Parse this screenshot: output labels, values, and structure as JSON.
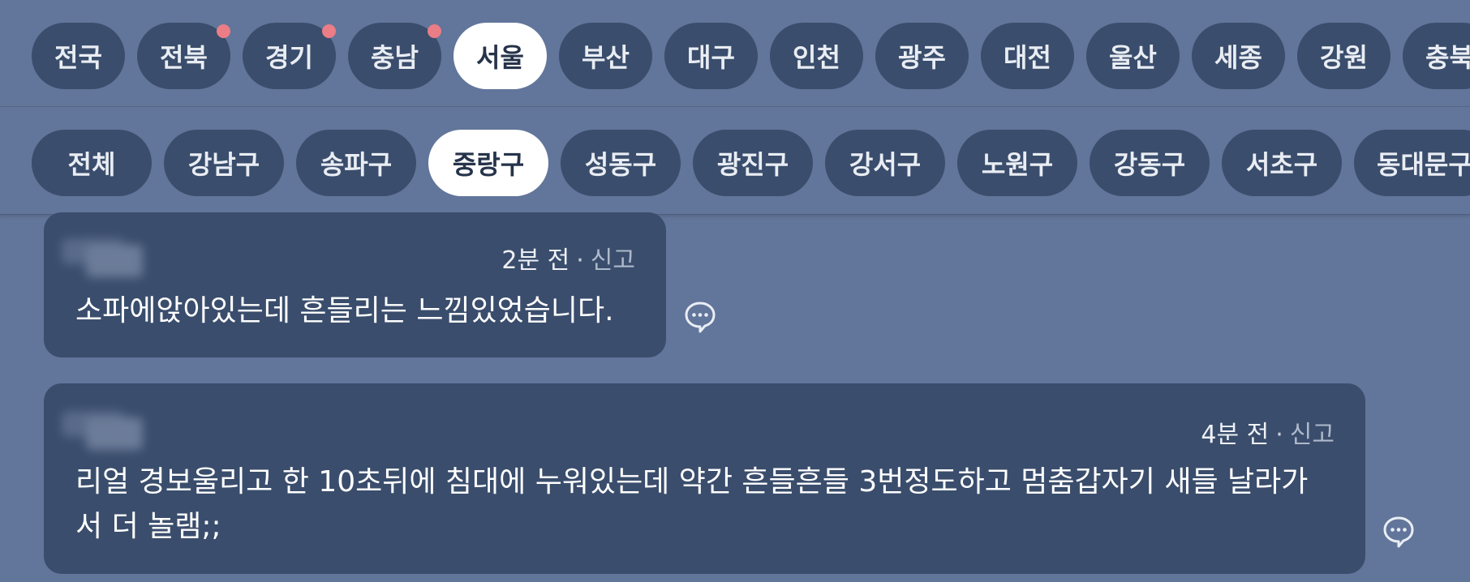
{
  "regions": [
    {
      "label": "전국",
      "dot": false,
      "active": false
    },
    {
      "label": "전북",
      "dot": true,
      "active": false
    },
    {
      "label": "경기",
      "dot": true,
      "active": false
    },
    {
      "label": "충남",
      "dot": true,
      "active": false
    },
    {
      "label": "서울",
      "dot": false,
      "active": true
    },
    {
      "label": "부산",
      "dot": false,
      "active": false
    },
    {
      "label": "대구",
      "dot": false,
      "active": false
    },
    {
      "label": "인천",
      "dot": false,
      "active": false
    },
    {
      "label": "광주",
      "dot": false,
      "active": false
    },
    {
      "label": "대전",
      "dot": false,
      "active": false
    },
    {
      "label": "울산",
      "dot": false,
      "active": false
    },
    {
      "label": "세종",
      "dot": false,
      "active": false
    },
    {
      "label": "강원",
      "dot": false,
      "active": false
    },
    {
      "label": "충북",
      "dot": false,
      "active": false
    }
  ],
  "districts": [
    {
      "label": "전체",
      "active": false
    },
    {
      "label": "강남구",
      "active": false
    },
    {
      "label": "송파구",
      "active": false
    },
    {
      "label": "중랑구",
      "active": true
    },
    {
      "label": "성동구",
      "active": false
    },
    {
      "label": "광진구",
      "active": false
    },
    {
      "label": "강서구",
      "active": false
    },
    {
      "label": "노원구",
      "active": false
    },
    {
      "label": "강동구",
      "active": false
    },
    {
      "label": "서초구",
      "active": false
    },
    {
      "label": "동대문구",
      "active": false
    }
  ],
  "comments": [
    {
      "time": "2분 전",
      "separator": "·",
      "report_label": "신고",
      "text": "소파에앉아있는데 흔들리는 느낌있었습니다."
    },
    {
      "time": "4분 전",
      "separator": "·",
      "report_label": "신고",
      "text": "리얼 경보울리고 한 10초뒤에 침대에 누워있는데 약간 흔들흔들 3번정도하고 멈춤갑자기 새들 날라가서 더 놀램;;"
    }
  ],
  "icons": {
    "reply": "comment-bubble-icon"
  },
  "colors": {
    "background": "#62759a",
    "chip": "#3a4d6c",
    "chip_active": "#ffffff",
    "notification_dot": "#ea7d86"
  }
}
